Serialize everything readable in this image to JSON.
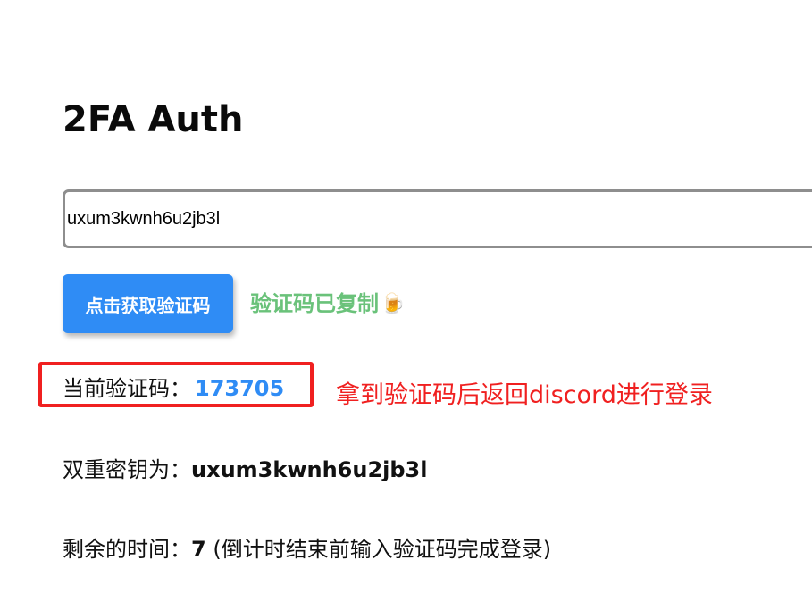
{
  "page": {
    "title": "2FA Auth"
  },
  "secret_input": {
    "value": "uxum3kwnh6u2jb3l"
  },
  "get_code_button": {
    "label": "点击获取验证码"
  },
  "copied_message": {
    "text": "验证码已复制",
    "icon": "beer-mug-icon",
    "icon_glyph": "🍺",
    "color": "#6ac27a"
  },
  "current_code": {
    "label": "当前验证码：",
    "value": "173705",
    "color": "#2f8cf5"
  },
  "annotation": {
    "text": "拿到验证码后返回discord进行登录",
    "color": "#f02020"
  },
  "secret_key": {
    "label": "双重密钥为：",
    "value": "uxum3kwnh6u2jb3l"
  },
  "remaining_time": {
    "label": "剩余的时间：",
    "value": "7",
    "note": "(倒计时结束前输入验证码完成登录)"
  },
  "colors": {
    "accent": "#2f8cf5",
    "success": "#6ac27a",
    "annotation_red": "#f02020"
  }
}
